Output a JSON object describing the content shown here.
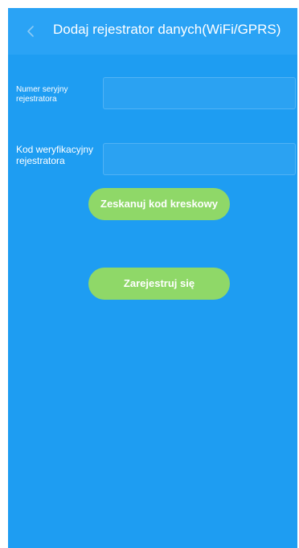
{
  "header": {
    "title": "Dodaj rejestrator danych(WiFi/GPRS)",
    "back_icon": "chevron-left-icon"
  },
  "form": {
    "serial_label": "Numer seryjny rejestratora",
    "serial_value": "",
    "code_label": "Kod weryfikacyjny rejestratora",
    "code_value": ""
  },
  "buttons": {
    "scan_label": "Zeskanuj kod kreskowy",
    "register_label": "Zarejestruj się"
  },
  "colors": {
    "background": "#1e9df2",
    "header": "#2aa3f5",
    "button": "#8fd868",
    "text": "#ffffff"
  }
}
